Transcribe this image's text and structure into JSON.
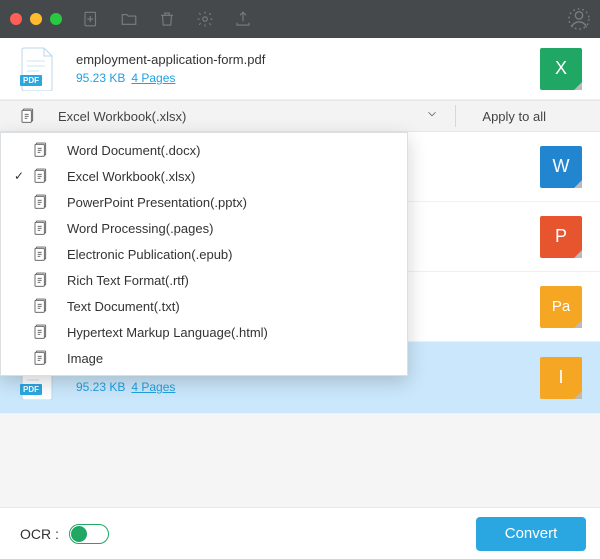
{
  "file": {
    "name": "employment-application-form.pdf",
    "size": "95.23 KB",
    "pages": "4 Pages"
  },
  "selector": {
    "current": "Excel Workbook(.xlsx)",
    "apply_all": "Apply to all"
  },
  "options": [
    "Word Document(.docx)",
    "Excel Workbook(.xlsx)",
    "PowerPoint Presentation(.pptx)",
    "Word Processing(.pages)",
    "Electronic Publication(.epub)",
    "Rich Text Format(.rtf)",
    "Text Document(.txt)",
    "Hypertext Markup Language(.html)",
    "Image"
  ],
  "targets": {
    "x": "X",
    "w": "W",
    "p": "P",
    "pa": "Pa",
    "i": "I"
  },
  "footer": {
    "ocr": "OCR :",
    "convert": "Convert"
  }
}
